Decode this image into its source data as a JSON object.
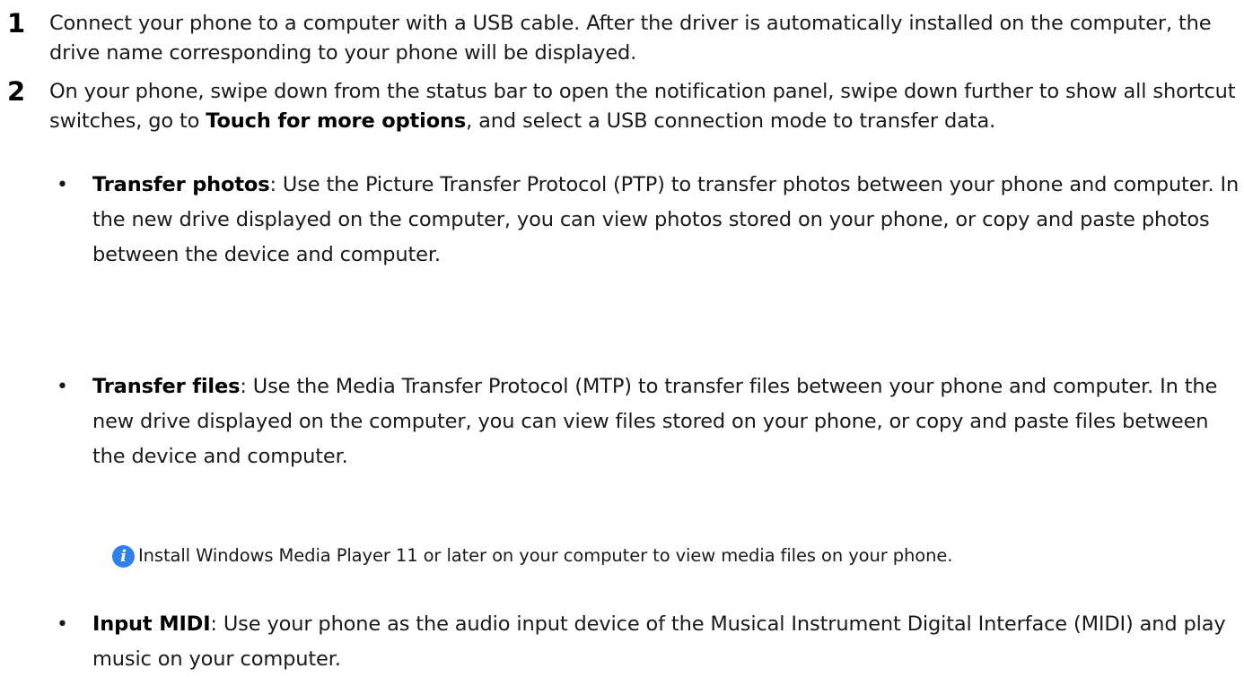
{
  "steps": [
    {
      "number": "1",
      "text": "Connect your phone to a computer with a USB cable. After the driver is automatically installed on the computer, the drive name corresponding to your phone will be displayed."
    },
    {
      "number": "2",
      "text_before": "On your phone, swipe down from the status bar to open the notification panel, swipe down further to show all shortcut switches, go to ",
      "bold": "Touch for more options",
      "text_after": ", and select a USB connection mode to transfer data."
    }
  ],
  "options": [
    {
      "title": "Transfer photos",
      "description": ": Use the Picture Transfer Protocol (PTP) to transfer photos between your phone and computer. In the new drive displayed on the computer, you can view photos stored on your phone, or copy and paste photos between the device and computer."
    },
    {
      "title": "Transfer files",
      "description": ": Use the Media Transfer Protocol (MTP) to transfer files between your phone and computer. In the new drive displayed on the computer, you can view files stored on your phone, or copy and paste files between the device and computer."
    },
    {
      "title": "Input MIDI",
      "description": ": Use your phone as the audio input device of the Musical Instrument Digital Interface (MIDI) and play music on your computer."
    }
  ],
  "note": {
    "icon": "info-icon",
    "icon_glyph": "i",
    "icon_color": "#2f80ed",
    "text": "Install Windows Media Player 11 or later on your computer to view media files on your phone."
  },
  "bullet_glyph": "•"
}
